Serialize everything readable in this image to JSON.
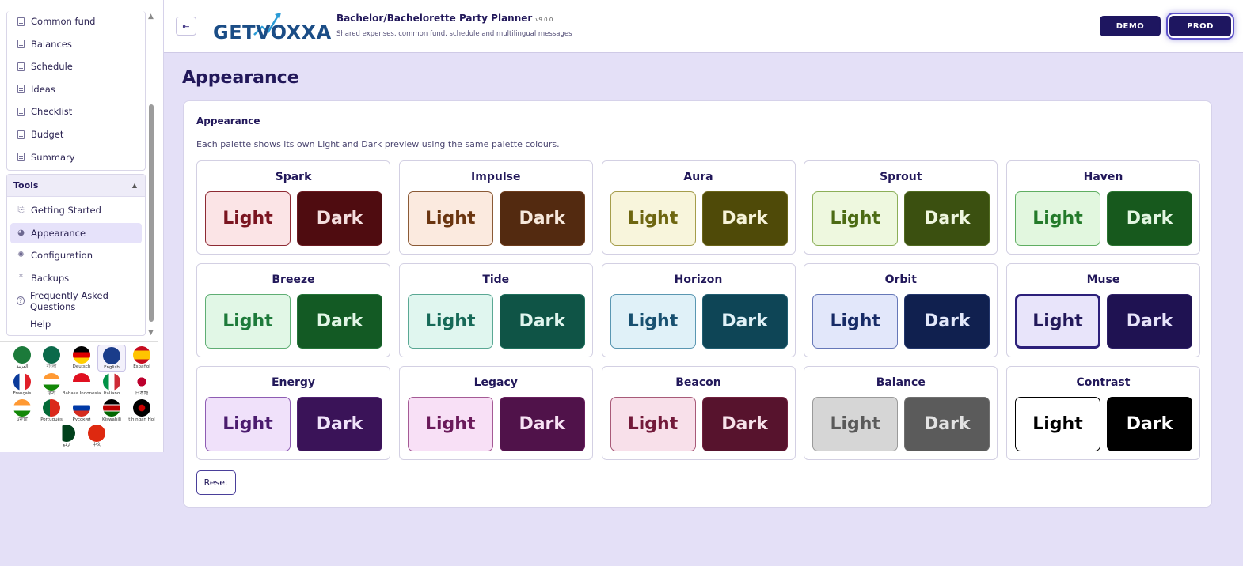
{
  "sidebar": {
    "nav_items": [
      {
        "label": "Common fund"
      },
      {
        "label": "Balances"
      },
      {
        "label": "Schedule"
      },
      {
        "label": "Ideas"
      },
      {
        "label": "Checklist"
      },
      {
        "label": "Budget"
      },
      {
        "label": "Summary"
      }
    ],
    "tools": {
      "heading": "Tools",
      "items": [
        {
          "label": "Getting Started",
          "icon": "getting-started-icon"
        },
        {
          "label": "Appearance",
          "icon": "palette-icon",
          "active": true
        },
        {
          "label": "Configuration",
          "icon": "gear-icon"
        },
        {
          "label": "Backups",
          "icon": "upload-icon"
        },
        {
          "label": "Frequently Asked Questions",
          "icon": "help-circle-icon"
        },
        {
          "label": "Help",
          "icon": ""
        }
      ]
    },
    "languages": [
      {
        "label": "العربية"
      },
      {
        "label": "বাংলা"
      },
      {
        "label": "Deutsch"
      },
      {
        "label": "English",
        "selected": true
      },
      {
        "label": "Español"
      },
      {
        "label": "Français"
      },
      {
        "label": "हिन्दी"
      },
      {
        "label": "Bahasa Indonesia"
      },
      {
        "label": "Italiano"
      },
      {
        "label": "日本語"
      },
      {
        "label": "ਪੰਜਾਬੀ"
      },
      {
        "label": "Português"
      },
      {
        "label": "Русский"
      },
      {
        "label": "Kiswahili"
      },
      {
        "label": "tlhIngan Hol"
      },
      {
        "label": "اردو"
      },
      {
        "label": "中文"
      }
    ]
  },
  "header": {
    "logo_text": "GETVOXXA",
    "title": "Bachelor/Bachelorette Party Planner",
    "version": "v9.0.0",
    "subtitle": "Shared expenses, common fund, schedule and multilingual messages",
    "demo_label": "DEMO",
    "prod_label": "PROD"
  },
  "main": {
    "page_title": "Appearance",
    "card_title": "Appearance",
    "description": "Each palette shows its own Light and Dark preview using the same palette colours.",
    "light_label": "Light",
    "dark_label": "Dark",
    "reset_label": "Reset",
    "palettes": [
      {
        "name": "Spark",
        "light_bg": "#fbe4e6",
        "light_fg": "#7a1420",
        "light_border": "#8e2a33",
        "dark_bg": "#4f0c10",
        "dark_fg": "#f4dede",
        "dark_border": "#6b1a20"
      },
      {
        "name": "Impulse",
        "light_bg": "#fbeadf",
        "light_fg": "#6a3510",
        "light_border": "#8b5a36",
        "dark_bg": "#532a10",
        "dark_fg": "#f6e8dc",
        "dark_border": "#6d3c1c"
      },
      {
        "name": "Aura",
        "light_bg": "#f8f5dc",
        "light_fg": "#6e6610",
        "light_border": "#a59d4c",
        "dark_bg": "#4f4a08",
        "dark_fg": "#f7f3d8",
        "dark_border": "#6a6418"
      },
      {
        "name": "Sprout",
        "light_bg": "#eef8df",
        "light_fg": "#4c6b14",
        "light_border": "#8caf58",
        "dark_bg": "#3b5010",
        "dark_fg": "#eff6df",
        "dark_border": "#506a20"
      },
      {
        "name": "Haven",
        "light_bg": "#e2f7df",
        "light_fg": "#237a2a",
        "light_border": "#5fae62",
        "dark_bg": "#17591d",
        "dark_fg": "#e3f6e2",
        "dark_border": "#2a7430"
      },
      {
        "name": "Breeze",
        "light_bg": "#e1f7e6",
        "light_fg": "#1d7a3a",
        "light_border": "#5fae74",
        "dark_bg": "#135a24",
        "dark_fg": "#e2f6e6",
        "dark_border": "#257439"
      },
      {
        "name": "Tide",
        "light_bg": "#e0f6ef",
        "light_fg": "#176a58",
        "light_border": "#5aa894",
        "dark_bg": "#0f5446",
        "dark_fg": "#e0f5ee",
        "dark_border": "#20705d"
      },
      {
        "name": "Horizon",
        "light_bg": "#e0f1f8",
        "light_fg": "#185070",
        "light_border": "#5a97b2",
        "dark_bg": "#0e4556",
        "dark_fg": "#e0f1f7",
        "dark_border": "#205d70"
      },
      {
        "name": "Orbit",
        "light_bg": "#e2e7fa",
        "light_fg": "#172b66",
        "light_border": "#6678b8",
        "dark_bg": "#10204f",
        "dark_fg": "#e3e8fa",
        "dark_border": "#23366c"
      },
      {
        "name": "Muse",
        "light_bg": "#e8e4fa",
        "light_fg": "#22185a",
        "light_border": "#2c1f7a",
        "dark_bg": "#1f1252",
        "dark_fg": "#e7e3fa",
        "dark_border": "#2f2168",
        "selected": true
      },
      {
        "name": "Energy",
        "light_bg": "#f0e1fa",
        "light_fg": "#4b1c6e",
        "light_border": "#8e5cb3",
        "dark_bg": "#3a1358",
        "dark_fg": "#f0e3fa",
        "dark_border": "#502272"
      },
      {
        "name": "Legacy",
        "light_bg": "#f8e0f6",
        "light_fg": "#6a1a5a",
        "light_border": "#a55a95",
        "dark_bg": "#50124a",
        "dark_fg": "#f7e2f4",
        "dark_border": "#6a205f"
      },
      {
        "name": "Beacon",
        "light_bg": "#f8e0ea",
        "light_fg": "#731a3a",
        "light_border": "#a85a78",
        "dark_bg": "#57132d",
        "dark_fg": "#f7e2ea",
        "dark_border": "#70203d"
      },
      {
        "name": "Balance",
        "light_bg": "#d6d6d6",
        "light_fg": "#5a5a5a",
        "light_border": "#9a9a9a",
        "dark_bg": "#5b5b5b",
        "dark_fg": "#e3e3e3",
        "dark_border": "#707070"
      },
      {
        "name": "Contrast",
        "light_bg": "#ffffff",
        "light_fg": "#000000",
        "light_border": "#000000",
        "dark_bg": "#000000",
        "dark_fg": "#ffffff",
        "dark_border": "#000000"
      }
    ]
  }
}
